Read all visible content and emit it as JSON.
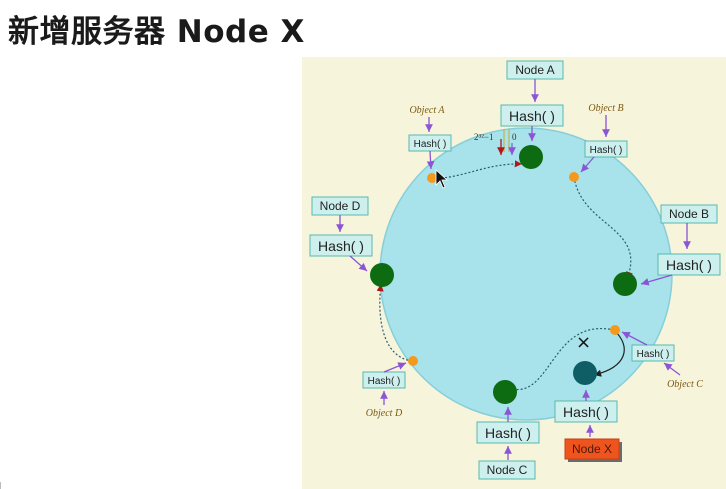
{
  "title": "新增服务器 Node X",
  "diagram": {
    "colors": {
      "background": "#f7f4dc",
      "ring": "#a8e2ea",
      "node": "#0d6b12",
      "new_node": "#0f5e66",
      "object": "#f39a1c",
      "arrow": "#8b55d6",
      "box_fill": "#cdf0ee",
      "box_border": "#57b8ae",
      "new_node_fill": "#f0541e"
    },
    "hash_label": "Hash( )",
    "nodes": [
      "Node A",
      "Node B",
      "Node C",
      "Node D",
      "Node X"
    ],
    "objects": [
      "Object A",
      "Object B",
      "Object C",
      "Object D"
    ],
    "ring_top_label": "2³²−1",
    "ring_zero_label": "0",
    "removed_mark": "×"
  }
}
